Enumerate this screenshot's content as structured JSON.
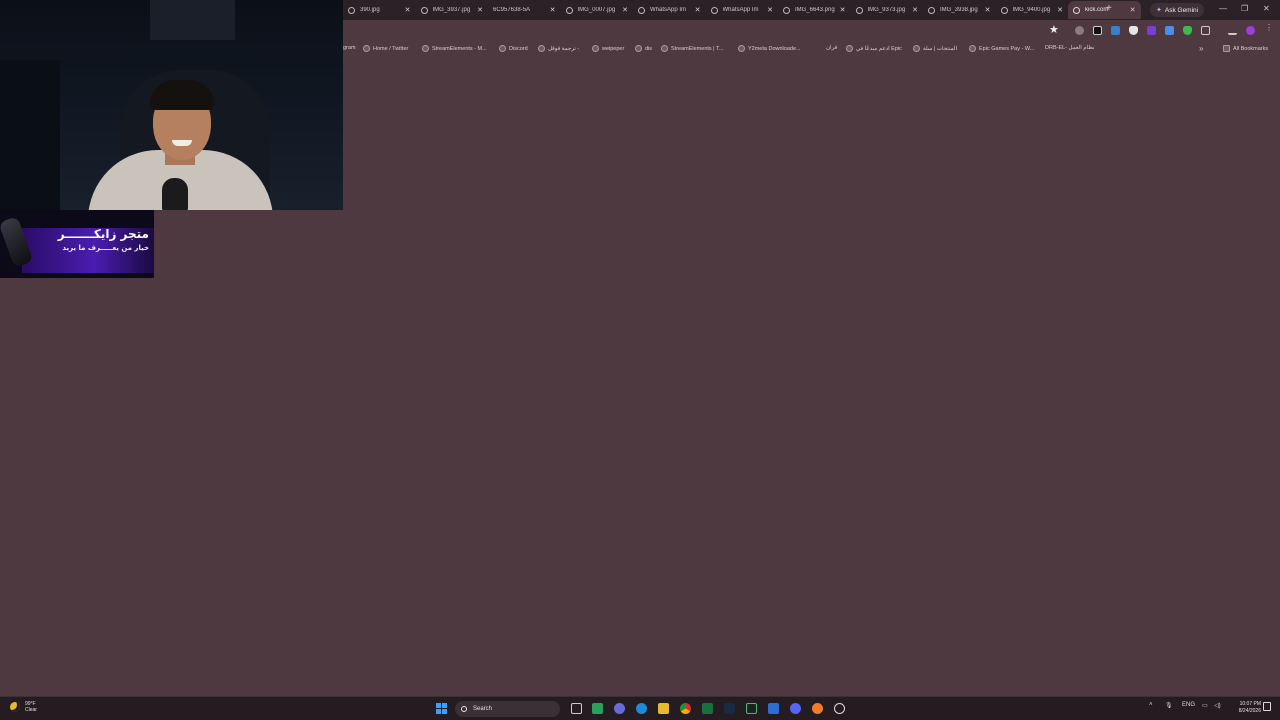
{
  "browser": {
    "tabs": [
      {
        "title": "390.jpg",
        "favicon": "image-file-icon"
      },
      {
        "title": "IMG_3937.jpg",
        "favicon": "globe-icon"
      },
      {
        "title": "6C957638-5A",
        "favicon": "none"
      },
      {
        "title": "IMG_0007.jpg",
        "favicon": "globe-icon"
      },
      {
        "title": "WhatsApp Im",
        "favicon": "globe-icon"
      },
      {
        "title": "WhatsApp Im",
        "favicon": "globe-icon"
      },
      {
        "title": "IMG_6643.png",
        "favicon": "globe-icon"
      },
      {
        "title": "IMG_9373.jpg",
        "favicon": "globe-icon"
      },
      {
        "title": "IMG_3938.jpg",
        "favicon": "globe-icon"
      },
      {
        "title": "IMG_9400.jpg",
        "favicon": "globe-icon"
      },
      {
        "title": "kick.com",
        "favicon": "loading-icon",
        "active": true
      }
    ],
    "new_tab_label": "+",
    "ask_gemini_label": "Ask Gemini",
    "window_controls": {
      "minimize": "—",
      "restore": "❐",
      "close": "✕"
    },
    "bookmarks": [
      {
        "label": "gram",
        "icon": "none"
      },
      {
        "label": "Home / Twitter",
        "icon": "x-icon"
      },
      {
        "label": "StreamElements - M...",
        "icon": "streamelements-icon"
      },
      {
        "label": "Discord",
        "icon": "discord-icon"
      },
      {
        "label": "ترجمة قوقل -",
        "icon": "google-translate-icon"
      },
      {
        "label": "weipeper",
        "icon": "bookmark-icon"
      },
      {
        "label": "dis",
        "icon": "discord-icon"
      },
      {
        "label": "StreamElements | T...",
        "icon": "streamelements-icon"
      },
      {
        "label": "Y2meta Downloade...",
        "icon": "y2meta-icon"
      },
      {
        "label": "قران",
        "icon": "none"
      },
      {
        "label": "ادعم مبدعًا في Epic",
        "icon": "epic-icon"
      },
      {
        "label": "المنتجات | سلة",
        "icon": "salla-icon"
      },
      {
        "label": "Epic Games Pay - W...",
        "icon": "globe-icon"
      },
      {
        "label": "DRB-EL- نظام العمل",
        "icon": "none"
      }
    ],
    "all_bookmarks_label": "All Bookmarks"
  },
  "overlay": {
    "store_title": "متجر زايكـــــــر",
    "store_tagline": "خيار من يعـــــرف ما يريد"
  },
  "taskbar": {
    "weather_temp": "99°F",
    "weather_condition": "Clear",
    "search_placeholder": "Search",
    "tray_language": "ENG",
    "clock_time": "10:07 PM",
    "clock_date": "8/24/2026"
  },
  "colors": {
    "page_background": "#4f3940",
    "tabstrip": "#2b2228",
    "taskbar": "#241c21",
    "accent_windows": "#3aa0ff"
  }
}
